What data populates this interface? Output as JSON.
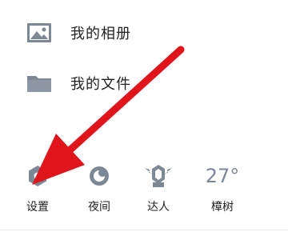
{
  "menu": {
    "items": [
      {
        "label": "我的相册",
        "icon": "photo-album-icon"
      },
      {
        "label": "我的文件",
        "icon": "folder-icon"
      }
    ]
  },
  "toolbar": {
    "settings_label": "设置",
    "night_label": "夜间",
    "expert_label": "达人",
    "weather_temp": "27°",
    "weather_location": "樟树"
  },
  "annotation": {
    "arrow_color": "#e0141b"
  },
  "colors": {
    "icon_gray": "#7d8896",
    "text": "#222222"
  }
}
